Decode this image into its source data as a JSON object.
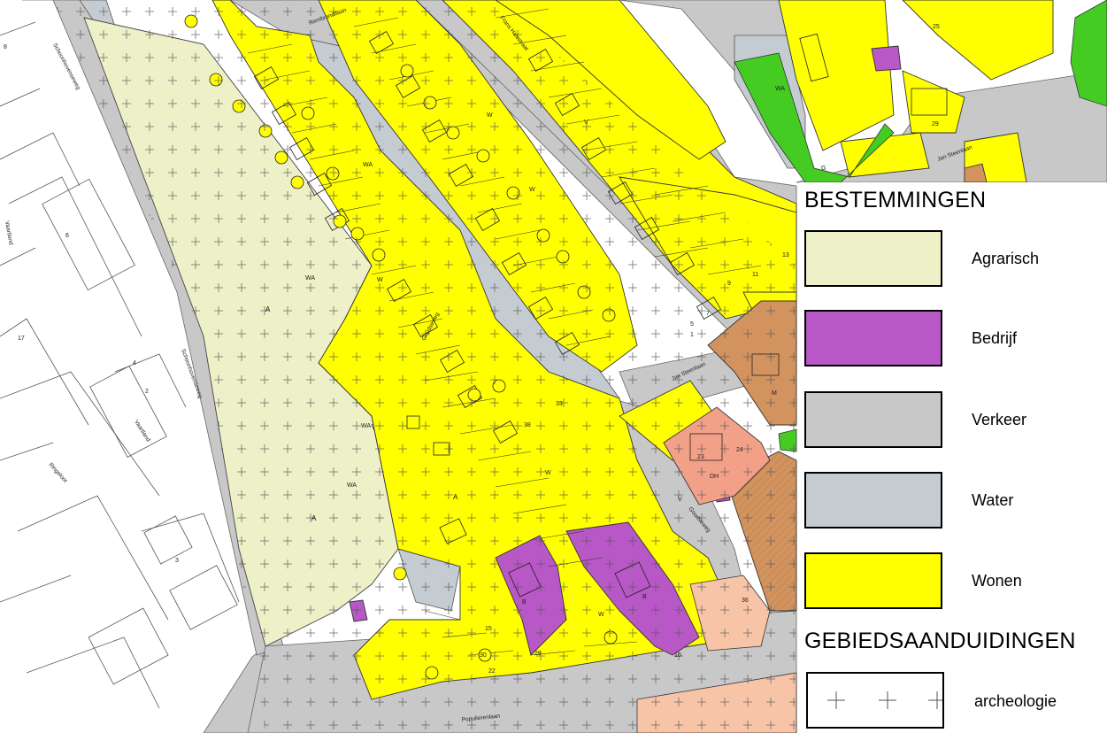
{
  "legend": {
    "heading_zoning": "BESTEMMINGEN",
    "heading_areas": "GEBIEDSAANDUIDINGEN",
    "items": [
      {
        "label": "Agrarisch",
        "color": "#eef0c8"
      },
      {
        "label": "Bedrijf",
        "color": "#b857c6"
      },
      {
        "label": "Verkeer",
        "color": "#c8c8c8"
      },
      {
        "label": "Water",
        "color": "#c4ccd1"
      },
      {
        "label": "Wonen",
        "color": "#ffff00"
      }
    ],
    "overlay_label": "archeologie"
  },
  "map": {
    "colors": {
      "agrarisch": "#eef0c8",
      "bedrijf": "#b857c6",
      "verkeer": "#c8c8c8",
      "water": "#c4ccd1",
      "wonen": "#ffff00",
      "groen": "#44cc22",
      "maatschappelijk": "#d2935e",
      "dienstverlening": "#f2a088",
      "peach": "#f8c4a8"
    },
    "streets": {
      "schoonhovenseweg": "Schoonhovenseweg",
      "rembrandtlaan": "Rembrandtlaan",
      "frans_halsstraat": "Frans Halsstraat",
      "goudseweg": "Goudseweg",
      "jan_steenlaan": "Jan Steenlaan",
      "vaartland": "Vaartland",
      "ringeloot": "Ringeloot",
      "populierenlaan": "Populierenlaan"
    },
    "zone_codes": {
      "agrarisch": "A",
      "water": "WA",
      "wonen": "W",
      "bedrijf": "B",
      "dienstverlening": "DH",
      "maatschappelijk": "M",
      "groen": "G",
      "verkeer": "V"
    },
    "house_numbers": [
      "23",
      "24",
      "28",
      "10",
      "29",
      "13",
      "11",
      "9",
      "7",
      "5",
      "1",
      "3",
      "2",
      "4",
      "6",
      "8",
      "17",
      "15",
      "22",
      "25",
      "30",
      "33",
      "36",
      "38"
    ]
  }
}
